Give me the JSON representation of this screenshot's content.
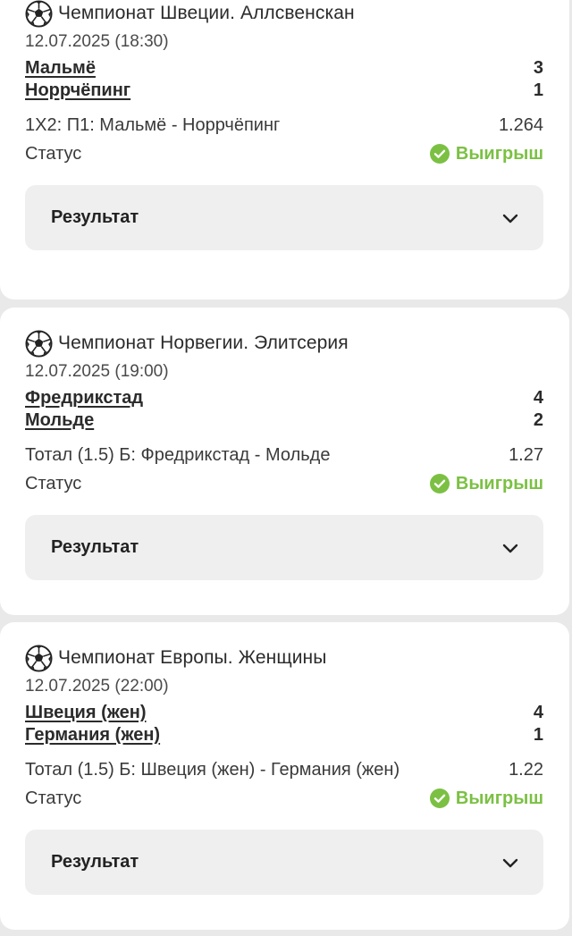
{
  "colors": {
    "background": "#e9e9e9",
    "card": "#ffffff",
    "win_green": "#7bc043",
    "result_box": "#efefef"
  },
  "cards": [
    {
      "league_icon": "soccer-ball-icon",
      "league": "Чемпионат Швеции. Аллсвенскан",
      "datetime": "12.07.2025 (18:30)",
      "home_team": "Мальмё",
      "home_score": "3",
      "away_team": "Норрчёпинг",
      "away_score": "1",
      "bet": "1X2: П1: Мальмё - Норрчёпинг",
      "odds": "1.264",
      "status_label": "Статус",
      "status_icon": "check-circle-icon",
      "status_value": "Выигрыш",
      "result_label": "Результат",
      "result_icon": "chevron-down-icon"
    },
    {
      "league_icon": "soccer-ball-icon",
      "league": "Чемпионат Норвегии. Элитсерия",
      "datetime": "12.07.2025 (19:00)",
      "home_team": "Фредрикстад",
      "home_score": "4",
      "away_team": "Мольде",
      "away_score": "2",
      "bet": "Тотал (1.5) Б: Фредрикстад - Мольде",
      "odds": "1.27",
      "status_label": "Статус",
      "status_icon": "check-circle-icon",
      "status_value": "Выигрыш",
      "result_label": "Результат",
      "result_icon": "chevron-down-icon"
    },
    {
      "league_icon": "soccer-ball-icon",
      "league": "Чемпионат Европы. Женщины",
      "datetime": "12.07.2025 (22:00)",
      "home_team": "Швеция (жен)",
      "home_score": "4",
      "away_team": "Германия (жен)",
      "away_score": "1",
      "bet": "Тотал (1.5) Б: Швеция (жен) - Германия (жен)",
      "odds": "1.22",
      "status_label": "Статус",
      "status_icon": "check-circle-icon",
      "status_value": "Выигрыш",
      "result_label": "Результат",
      "result_icon": "chevron-down-icon"
    }
  ]
}
